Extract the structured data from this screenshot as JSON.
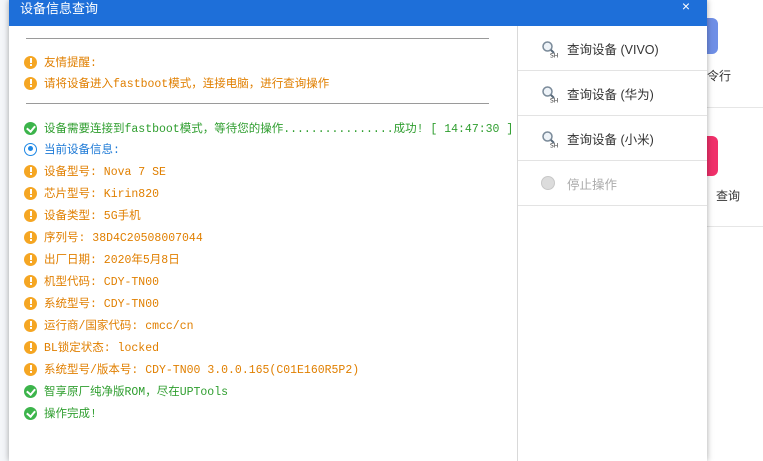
{
  "background": {
    "right_labels": [
      "令行",
      "查询"
    ]
  },
  "dialog": {
    "title": "设备信息查询",
    "close_glyph": "×"
  },
  "log": [
    {
      "icon": "warn",
      "color": "orange",
      "text": "友情提醒:"
    },
    {
      "icon": "warn",
      "color": "orange",
      "text": "请将设备进入fastboot模式，连接电脑，进行查询操作"
    },
    {
      "icon": "ok",
      "color": "green",
      "text": "设备需要连接到fastboot模式，等待您的操作................成功! [ 14:47:30 ]"
    },
    {
      "icon": "info",
      "color": "blue",
      "text": "当前设备信息:"
    },
    {
      "icon": "warn",
      "color": "orange",
      "text": "设备型号: Nova 7 SE"
    },
    {
      "icon": "warn",
      "color": "orange",
      "text": "芯片型号: Kirin820"
    },
    {
      "icon": "warn",
      "color": "orange",
      "text": "设备类型: 5G手机"
    },
    {
      "icon": "warn",
      "color": "orange",
      "text": "序列号: 38D4C20508007044"
    },
    {
      "icon": "warn",
      "color": "orange",
      "text": "出厂日期: 2020年5月8日"
    },
    {
      "icon": "warn",
      "color": "orange",
      "text": "机型代码: CDY-TN00"
    },
    {
      "icon": "warn",
      "color": "orange",
      "text": "系统型号: CDY-TN00"
    },
    {
      "icon": "warn",
      "color": "orange",
      "text": "运行商/国家代码: cmcc/cn"
    },
    {
      "icon": "warn",
      "color": "orange",
      "text": "BL锁定状态: locked"
    },
    {
      "icon": "warn",
      "color": "orange",
      "text": "系统型号/版本号: CDY-TN00 3.0.0.165(C01E160R5P2)"
    },
    {
      "icon": "ok",
      "color": "green",
      "text": "智享原厂纯净版ROM，尽在UPTools"
    },
    {
      "icon": "ok",
      "color": "green",
      "text": "操作完成!"
    }
  ],
  "actions": {
    "query_vivo": "查询设备 (VIVO)",
    "query_huawei": "查询设备 (华为)",
    "query_xiaomi": "查询设备 (小米)",
    "stop": "停止操作"
  },
  "colors": {
    "titlebar": "#1e6fd9",
    "warn": "#f5a623",
    "ok": "#3cb44b",
    "info": "#1e88e5"
  }
}
